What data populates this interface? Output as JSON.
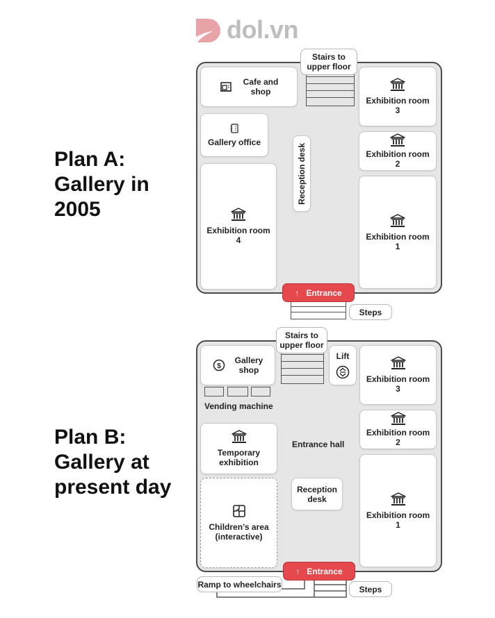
{
  "brand": {
    "name": "dol.vn",
    "logo_color": "#e8a3a6"
  },
  "colors": {
    "entrance": "#e5484d",
    "floor": "#e6e6e6",
    "wall": "#4a4a4a"
  },
  "plan_a": {
    "title_line1": "Plan A:",
    "title_line2": "Gallery in",
    "title_line3": "2005",
    "stairs_label_1": "Stairs to",
    "stairs_label_2": "upper floor",
    "cafe_1": "Cafe and",
    "cafe_2": "shop",
    "office": "Gallery office",
    "reception": "Reception desk",
    "room4_1": "Exhibition room",
    "room4_2": "4",
    "room3_1": "Exhibition room",
    "room3_2": "3",
    "room2_1": "Exhibition room",
    "room2_2": "2",
    "room1_1": "Exhibition room",
    "room1_2": "1",
    "entrance": "Entrance",
    "steps": "Steps"
  },
  "plan_b": {
    "title_line1": "Plan B:",
    "title_line2": "Gallery at",
    "title_line3": "present day",
    "stairs_label_1": "Stairs to",
    "stairs_label_2": "upper floor",
    "shop_1": "Gallery",
    "shop_2": "shop",
    "lift": "Lift",
    "vending": "Vending machine",
    "temp_1": "Temporary",
    "temp_2": "exhibition",
    "entrance_hall": "Entrance hall",
    "reception_1": "Reception",
    "reception_2": "desk",
    "children_1": "Children’s area",
    "children_2": "(interactive)",
    "room3_1": "Exhibition room",
    "room3_2": "3",
    "room2_1": "Exhibition room",
    "room2_2": "2",
    "room1_1": "Exhibition room",
    "room1_2": "1",
    "entrance": "Entrance",
    "steps": "Steps",
    "ramp": "Ramp to wheelchairs"
  },
  "icons": {
    "arrow": "↑"
  }
}
